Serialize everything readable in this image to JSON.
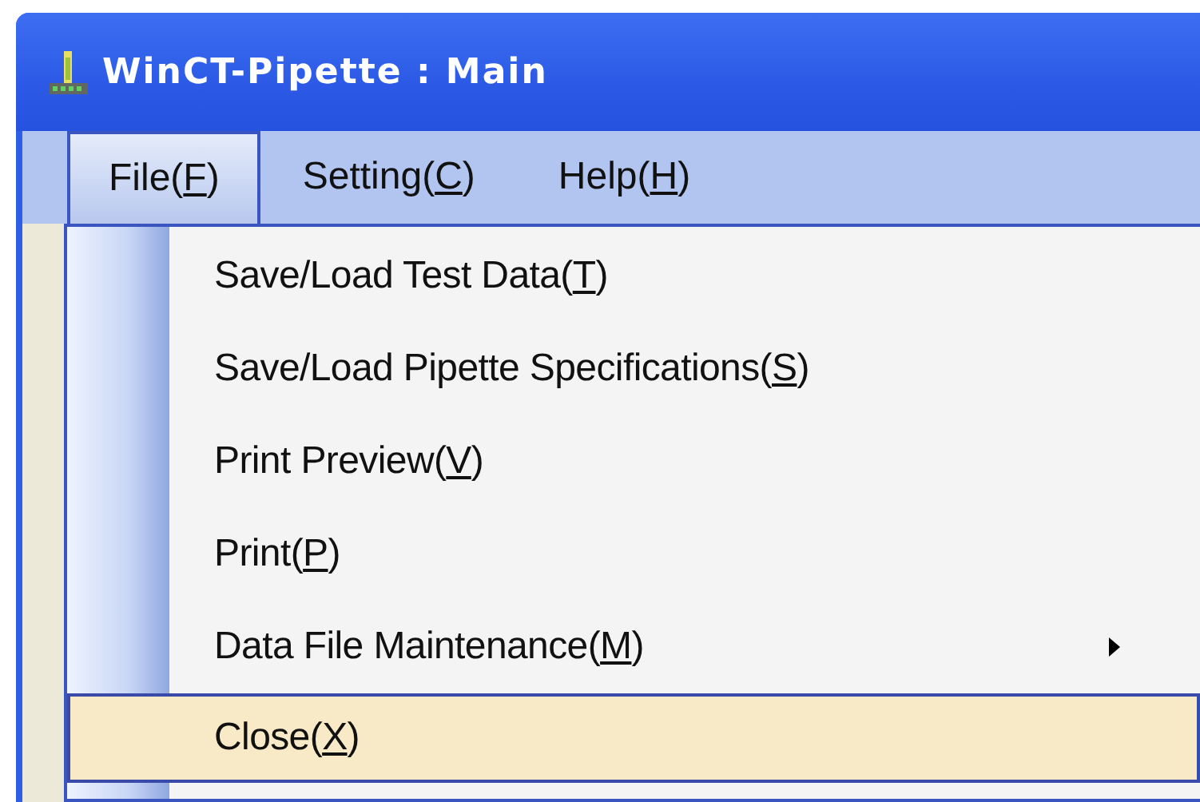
{
  "window": {
    "title": "WinCT-Pipette : Main"
  },
  "menu_bar": [
    {
      "label": "File(F)",
      "selected": true
    },
    {
      "label": "Setting(C)",
      "selected": false
    },
    {
      "label": "Help(H)",
      "selected": false
    }
  ],
  "file_menu": [
    {
      "label": "Save/Load Test Data(T)",
      "submenu": false,
      "selected": false
    },
    {
      "label": "Save/Load Pipette Specifications(S)",
      "submenu": false,
      "selected": false
    },
    {
      "label": "Print Preview(V)",
      "submenu": false,
      "selected": false
    },
    {
      "label": "Print(P)",
      "submenu": false,
      "selected": false
    },
    {
      "label": "Data File Maintenance(M)",
      "submenu": true,
      "selected": false
    },
    {
      "label": "Close(X)",
      "submenu": false,
      "selected": true
    }
  ]
}
